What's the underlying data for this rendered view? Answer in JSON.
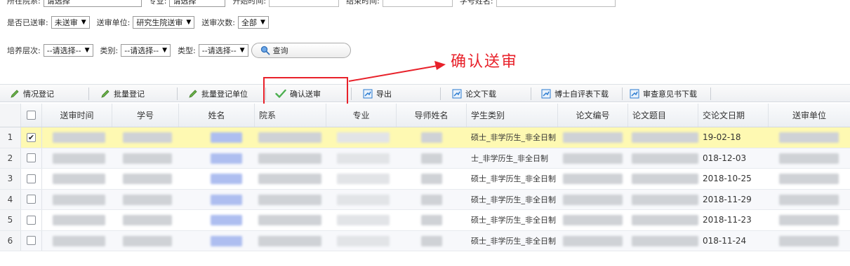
{
  "filters": {
    "row0": [
      {
        "label": "所在院系:",
        "value": "请选择"
      },
      {
        "label": "专业:",
        "value": "请选择"
      },
      {
        "label": "开始时间:",
        "value": ""
      },
      {
        "label": "结束时间:",
        "value": ""
      },
      {
        "label": "学号姓名:",
        "value": ""
      }
    ],
    "sent_label": "是否已送审:",
    "sent_value": "未送审",
    "unit_label": "送审单位:",
    "unit_value": "研究生院送审",
    "count_label": "送审次数:",
    "count_value": "全部",
    "level_label": "培养层次:",
    "level_value": "--请选择--",
    "category_label": "类别:",
    "category_value": "--请选择--",
    "type_label": "类型:",
    "type_value": "--请选择--",
    "query_label": "查询"
  },
  "annotation": {
    "text": "确认送审",
    "color": "#e8212a"
  },
  "toolbar": [
    {
      "label": "情况登记",
      "icon": "pencil-icon"
    },
    {
      "label": "批量登记",
      "icon": "pencil-icon"
    },
    {
      "label": "批量登记单位",
      "icon": "pencil-icon"
    },
    {
      "label": "确认送审",
      "icon": "checkmark-icon"
    },
    {
      "label": "导出",
      "icon": "export-icon"
    },
    {
      "label": "论文下载",
      "icon": "export-icon"
    },
    {
      "label": "博士自评表下载",
      "icon": "export-icon"
    },
    {
      "label": "审查意见书下载",
      "icon": "export-icon"
    }
  ],
  "table": {
    "columns": [
      "送审时间",
      "学号",
      "姓名",
      "院系",
      "专业",
      "导师姓名",
      "学生类别",
      "论文编号",
      "论文题目",
      "交论文日期",
      "送审单位"
    ],
    "rows": [
      {
        "num": "1",
        "checked": true,
        "student_type": "硕士_非学历生_非全日制",
        "submit_date": "19-02-18"
      },
      {
        "num": "2",
        "checked": false,
        "student_type": "士_非学历生_非全日制",
        "submit_date": "018-12-03"
      },
      {
        "num": "3",
        "checked": false,
        "student_type": "硕士_非学历生_非全日制",
        "submit_date": "2018-10-25"
      },
      {
        "num": "4",
        "checked": false,
        "student_type": "硕士_非学历生_非全日制",
        "submit_date": "2018-11-29"
      },
      {
        "num": "5",
        "checked": false,
        "student_type": "硕士_非学历生_非全日制",
        "submit_date": "2018-11-23"
      },
      {
        "num": "6",
        "checked": false,
        "student_type": "硕士_非学历生_非全日制",
        "submit_date": "018-11-24"
      }
    ]
  },
  "colors": {
    "accent": "#e8212a",
    "selected_row": "#fef9b2",
    "check_green": "#4caf50",
    "export_blue": "#2b7bd0"
  }
}
